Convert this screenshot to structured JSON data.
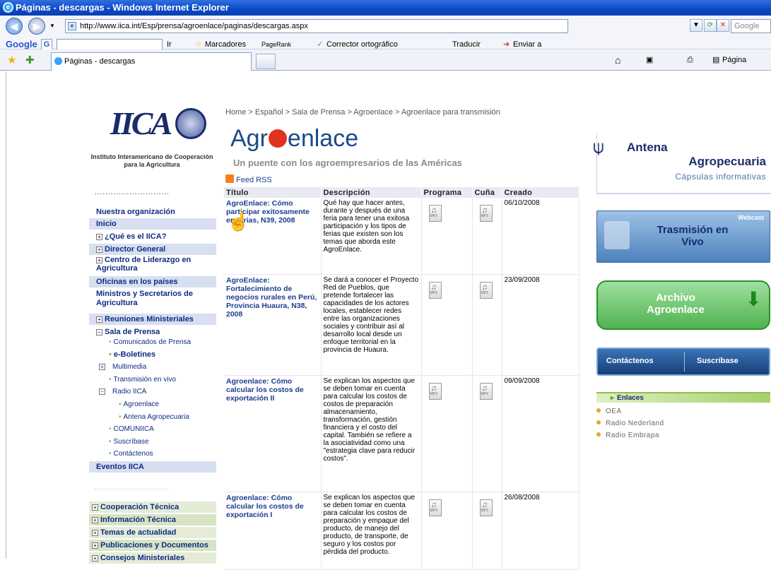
{
  "window": {
    "title": "Páginas - descargas - Windows Internet Explorer"
  },
  "address": {
    "url": "http://www.iica.int/Esp/prensa/agroenlace/paginas/descargas.aspx",
    "search_placeholder": "Google"
  },
  "google_toolbar": {
    "logo": "Google",
    "go_label": "Ir",
    "bookmarks": "Marcadores",
    "pagerank": "PageRank",
    "spell": "Corrector ortográfico",
    "translate": "Traducir",
    "send": "Enviar a"
  },
  "tabs": {
    "active": "Páginas - descargas"
  },
  "command_bar": {
    "page": "Página"
  },
  "sidebar": {
    "institute": "Instituto Interamericano de Cooperación para la Agricultura",
    "dots": "............................",
    "items": [
      {
        "label": "Nuestra organización"
      },
      {
        "label": "Inicio"
      },
      {
        "label": "¿Qué es el IICA?"
      },
      {
        "label": "Director General"
      },
      {
        "label": "Centro de Liderazgo en Agricultura"
      },
      {
        "label": "Oficinas en los países"
      },
      {
        "label": "Ministros y Secretarios de Agricultura"
      },
      {
        "label": "Reuniones Ministeriales"
      },
      {
        "label": "Sala de Prensa"
      }
    ],
    "subitems": [
      "Comunicados de Prensa",
      "e-Boletines",
      "Multimedia",
      "Transmisión en vivo",
      "Radio IICA",
      "Agroenlace",
      "Antena Agropecuaria",
      "COMUNIICA",
      "Suscríbase",
      "Contáctenos"
    ],
    "eventos": "Eventos IICA",
    "bottom_items": [
      "Cooperación Técnica",
      "Información Técnica",
      "Temas de actualidad",
      "Publicaciones y Documentos",
      "Consejos Ministeriales"
    ]
  },
  "main": {
    "breadcrumb": "Home > Español > Sala de Prensa > Agroenlace > Agroenlace para transmisión",
    "brand_left": "Agr",
    "brand_right": "enlace",
    "tagline": "Un puente con los agroempresarios de las Américas",
    "rss": "Feed RSS",
    "columns": [
      "Título",
      "Descripción",
      "Programa",
      "Cuña",
      "Creado"
    ],
    "rows": [
      {
        "title": "AgroEnlace: Cómo participar exitosamente en ferias, N39, 2008",
        "desc": "Qué hay que hacer antes, durante y después de una feria para tener una exitosa participación y los tipos de ferias que existen son los temas que aborda este AgroEnlace.",
        "date": "06/10/2008"
      },
      {
        "title": "AgroEnlace: Fortalecimiento de negocios rurales en Perú, Provincia Huaura, N38, 2008",
        "desc": "Se dará a conocer el Proyecto Red de Pueblos, que pretende fortalecer las capacidades de los actores locales, establecer redes entre las organizaciones sociales y contribuir así al desarrollo local desde un enfoque territorial en la provincia de Huaura.",
        "date": "23/09/2008"
      },
      {
        "title": "Agroenlace: Cómo calcular los costos de exportación II",
        "desc": "Se explican los aspectos que se deben tomar en cuenta para calcular los costos de costos de preparación almacenamiento, transformación, gestión financiera y el costo del capital. También se refiere a la asociatividad como una \"estrategia clave para reducir costos\".",
        "date": "09/09/2008"
      },
      {
        "title": "Agroenlace: Cómo calcular los costos de exportación I",
        "desc": "Se explican los aspectos que se deben tomar en cuenta para calcular los costos de preparación y empaque del producto, de manejo del producto, de transporte, de seguro y los costos por pérdida del producto.",
        "date": "26/08/2008"
      }
    ],
    "mp3_label": "MP3"
  },
  "right": {
    "antena_1": "Antena",
    "antena_2": "Agropecuaria",
    "antena_3": "Cápsulas informativas",
    "webcast_tag": "Webcast",
    "webcast": "Trasmisión en Vivo",
    "archivo": "Archivo Agroenlace",
    "contactenos": "Contáctenos",
    "suscribase": "Suscríbase",
    "enlaces_head": "Enlaces",
    "links": [
      "OEA",
      "Radio Nederland",
      "Radio Embrapa"
    ]
  }
}
